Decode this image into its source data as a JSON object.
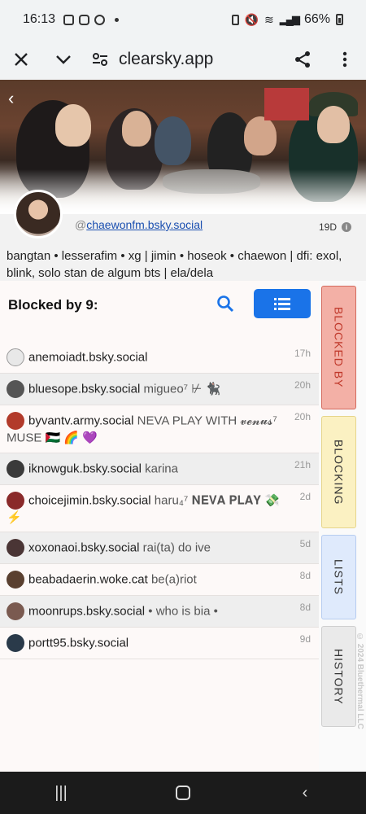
{
  "status": {
    "time": "16:13",
    "battery": "66%"
  },
  "browser": {
    "url": "clearsky.app",
    "icons": [
      "close-icon",
      "chevron-down-icon",
      "site-settings-icon",
      "share-icon",
      "more-vert-icon"
    ]
  },
  "profile": {
    "handle_prefix": "@",
    "handle": "chaewonfm.bsky.social",
    "age": "19D",
    "bio": "bangtan • lesserafim • xg | jimin • hoseok • chaewon | dfi: exol, blink, solo stan de algum bts | ela/dela"
  },
  "panel": {
    "title": "Blocked by 9:",
    "icons": [
      "search-icon",
      "list-view-icon"
    ]
  },
  "rows": [
    {
      "handle": "anemoiadt.bsky.social",
      "bio": "",
      "time": "17h",
      "color": "#e8e8e8"
    },
    {
      "handle": "bluesope.bsky.social",
      "bio": "migueo⁷ ⊬ 🐈‍⬛",
      "time": "20h",
      "color": "#555555"
    },
    {
      "handle": "byvantv.army.social",
      "bio": "NEVA PLAY WITH 𝓿𝓮𝓷𝓾𝓼⁷ MUSE 🇵🇸 🌈 💜",
      "time": "20h",
      "color": "#b23a2a"
    },
    {
      "handle": "iknowguk.bsky.social",
      "bio": "karina",
      "time": "21h",
      "color": "#3a3a3a"
    },
    {
      "handle": "choicejimin.bsky.social",
      "bio": "haru₄⁷ 𝐍𝐄𝐕𝐀 𝐏𝐋𝐀𝐘 💸 ⚡",
      "time": "2d",
      "color": "#8a2a2a"
    },
    {
      "handle": "xoxonaoi.bsky.social",
      "bio": "rai(ta) do ive",
      "time": "5d",
      "color": "#4a3535"
    },
    {
      "handle": "beabadaerin.woke.cat",
      "bio": "be(a)riot",
      "time": "8d",
      "color": "#5a4030"
    },
    {
      "handle": "moonrups.bsky.social",
      "bio": "• who is bia •",
      "time": "8d",
      "color": "#7a5a50"
    },
    {
      "handle": "portt95.bsky.social",
      "bio": "",
      "time": "9d",
      "color": "#2a3a4a"
    }
  ],
  "tabs": {
    "blocked_by": "BLOCKED BY",
    "blocking": "BLOCKING",
    "lists": "LISTS",
    "history": "HISTORY"
  },
  "copyright": "© 2024 Bluethermal LLC",
  "colors": {
    "accent": "#1a73e8",
    "blocked_tab": "#f3b0a6",
    "blocking_tab": "#fbf1c2",
    "lists_tab": "#dfeafc",
    "history_tab": "#eaeaea"
  }
}
